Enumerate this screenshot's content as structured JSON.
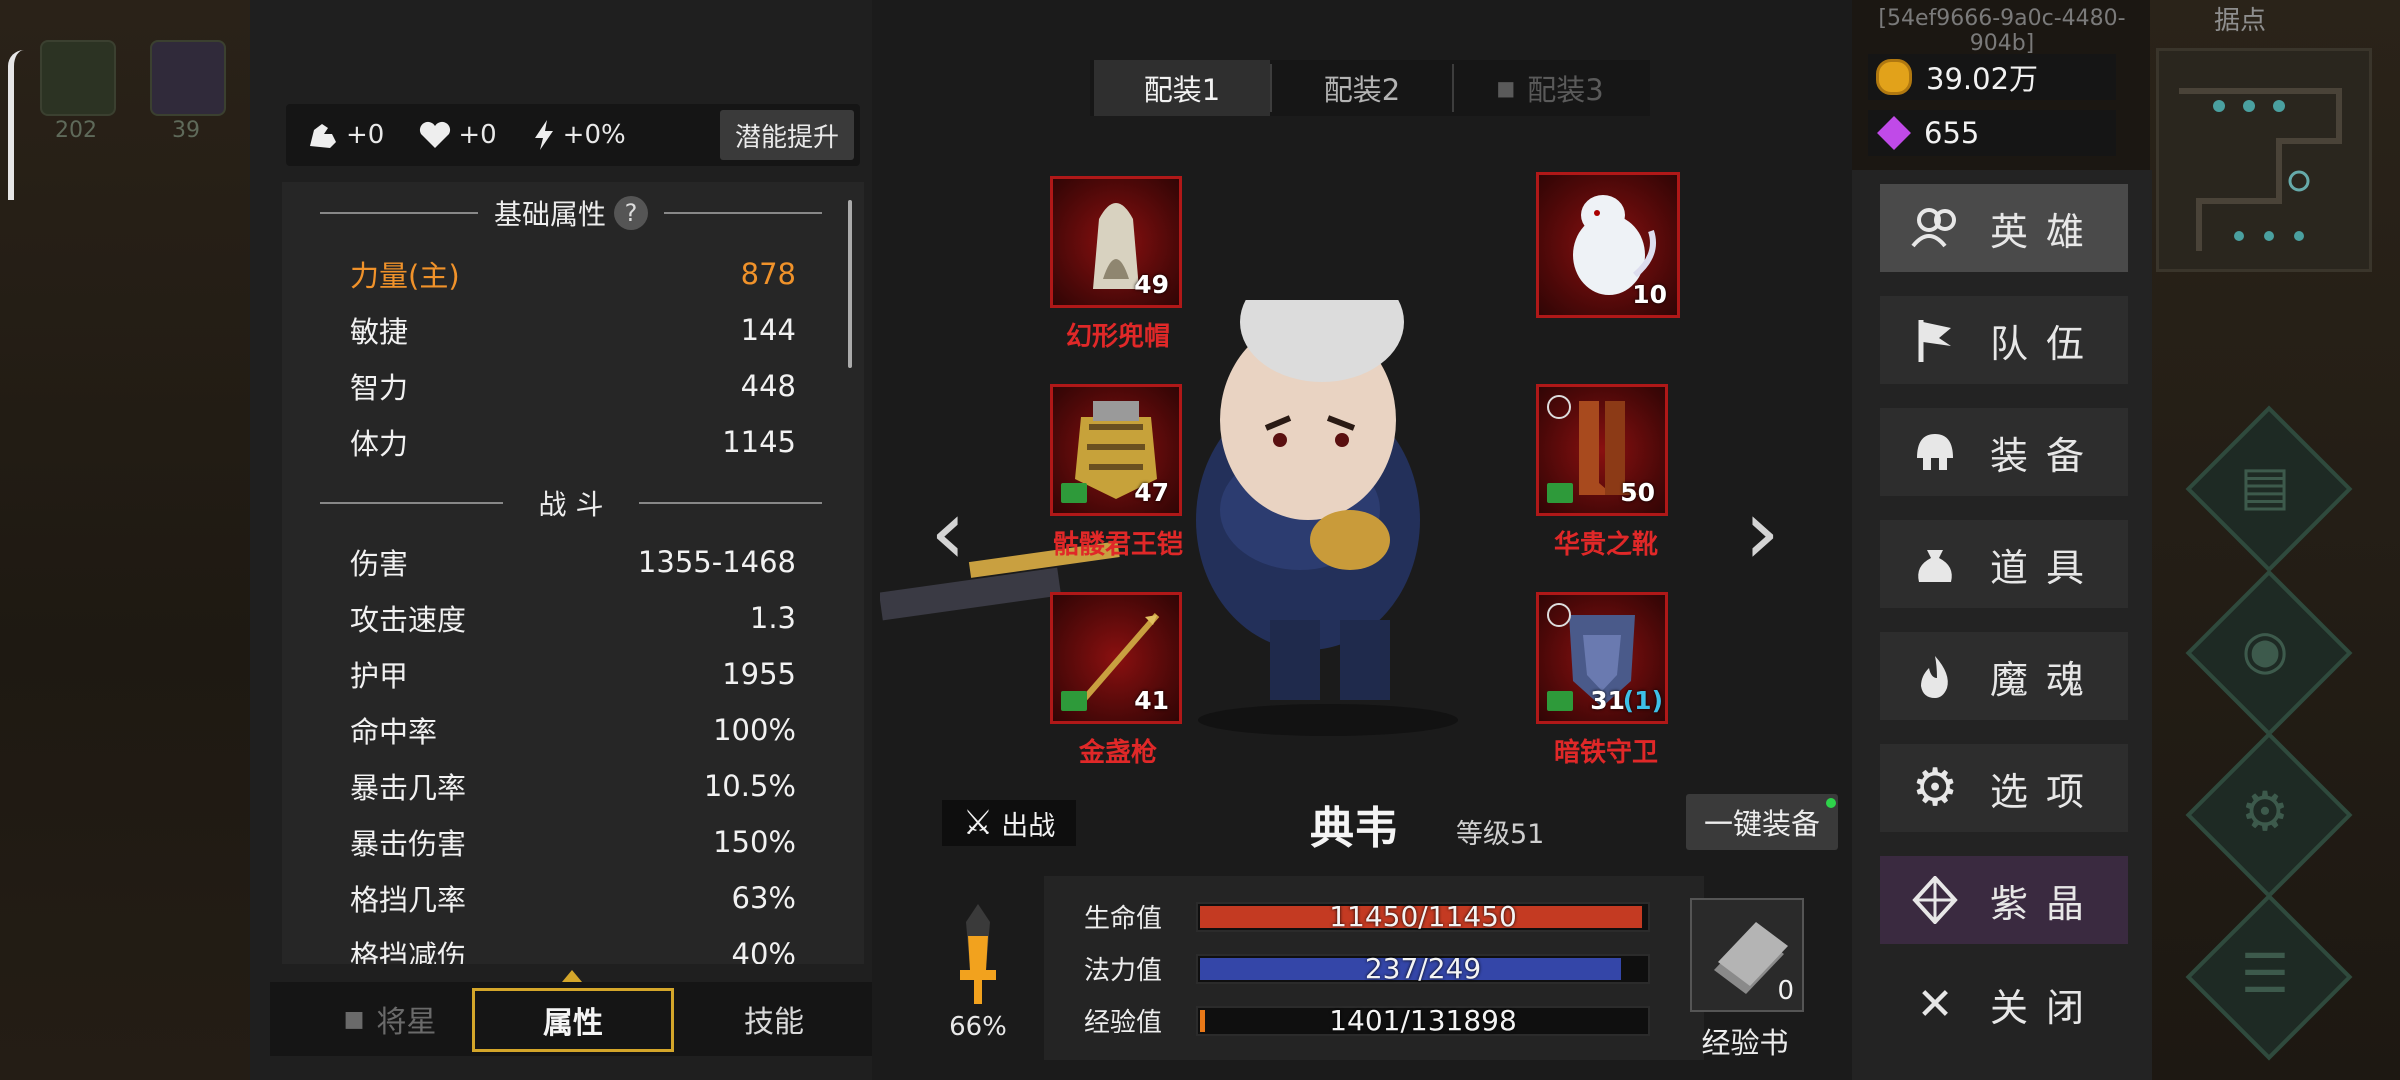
{
  "background": {
    "left_slot_counts": [
      "202",
      "39"
    ],
    "stronghold_label": "据点"
  },
  "session_id": "[54ef9666-9a0c-4480-904b]",
  "potential": {
    "strength_bonus": "+0",
    "hp_bonus": "+0",
    "energy_bonus": "+0%",
    "button_label": "潜能提升"
  },
  "stats": {
    "basic_title": "基础属性",
    "help_glyph": "?",
    "basic": [
      {
        "label": "力量(主)",
        "value": "878"
      },
      {
        "label": "敏捷",
        "value": "144"
      },
      {
        "label": "智力",
        "value": "448"
      },
      {
        "label": "体力",
        "value": "1145"
      }
    ],
    "combat_title": "战 斗",
    "combat": [
      {
        "label": "伤害",
        "value": "1355-1468"
      },
      {
        "label": "攻击速度",
        "value": "1.3"
      },
      {
        "label": "护甲",
        "value": "1955"
      },
      {
        "label": "命中率",
        "value": "100%"
      },
      {
        "label": "暴击几率",
        "value": "10.5%"
      },
      {
        "label": "暴击伤害",
        "value": "150%"
      },
      {
        "label": "格挡几率",
        "value": "63%"
      },
      {
        "label": "格挡减伤",
        "value": "40%"
      }
    ]
  },
  "bottom_tabs": {
    "general_star": "将星",
    "attributes": "属性",
    "skills": "技能"
  },
  "loadouts": [
    "配装1",
    "配装2",
    "配装3"
  ],
  "equipment": {
    "helmet": {
      "name": "幻形兜帽",
      "level": "49"
    },
    "pet": {
      "level": "10"
    },
    "armor": {
      "name": "骷髅君王铠",
      "level": "47"
    },
    "boots": {
      "name": "华贵之靴",
      "level": "50"
    },
    "weapon": {
      "name": "金盏枪",
      "level": "41"
    },
    "shield": {
      "name": "暗铁守卫",
      "level": "31",
      "extra": "(1)"
    }
  },
  "hero": {
    "deploy_label": "出战",
    "name": "典韦",
    "level": "等级51",
    "equip_all_label": "一键装备",
    "hp_label": "生命值",
    "hp_text": "11450/11450",
    "hp_fraction": 1.0,
    "mp_label": "法力值",
    "mp_text": "237/249",
    "mp_fraction": 0.952,
    "exp_label": "经验值",
    "exp_text": "1401/131898",
    "exp_fraction": 0.011,
    "morale_pct": "66%",
    "exp_book_count": "0",
    "exp_book_label": "经验书"
  },
  "currency": {
    "gold": "39.02万",
    "gems": "655"
  },
  "menu": [
    "英雄",
    "队伍",
    "装备",
    "道具",
    "魔魂",
    "选项",
    "紫晶",
    "关闭"
  ],
  "colors": {
    "accent_orange": "#f0922a",
    "item_name_red": "#e02828",
    "hp_red": "#c43a22",
    "mp_blue": "#3446a8",
    "exp_orange": "#e87818",
    "selected_tab_gold": "#d4a62a",
    "crystal_purple": "#b04ad8"
  }
}
